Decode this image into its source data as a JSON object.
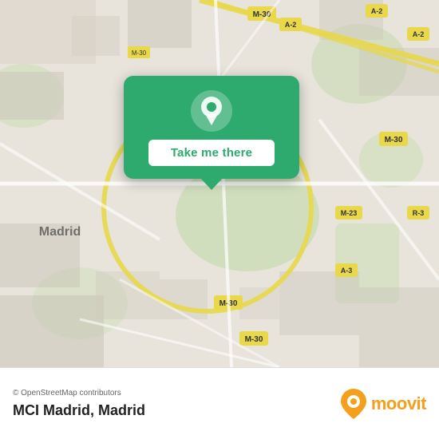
{
  "map": {
    "attribution": "© OpenStreetMap contributors",
    "background_color": "#e8e0d8"
  },
  "popup": {
    "button_label": "Take me there",
    "bg_color": "#2eaa6e"
  },
  "bottom_bar": {
    "location_name": "MCI Madrid,",
    "location_city": "Madrid",
    "moovit_label": "moovit"
  }
}
